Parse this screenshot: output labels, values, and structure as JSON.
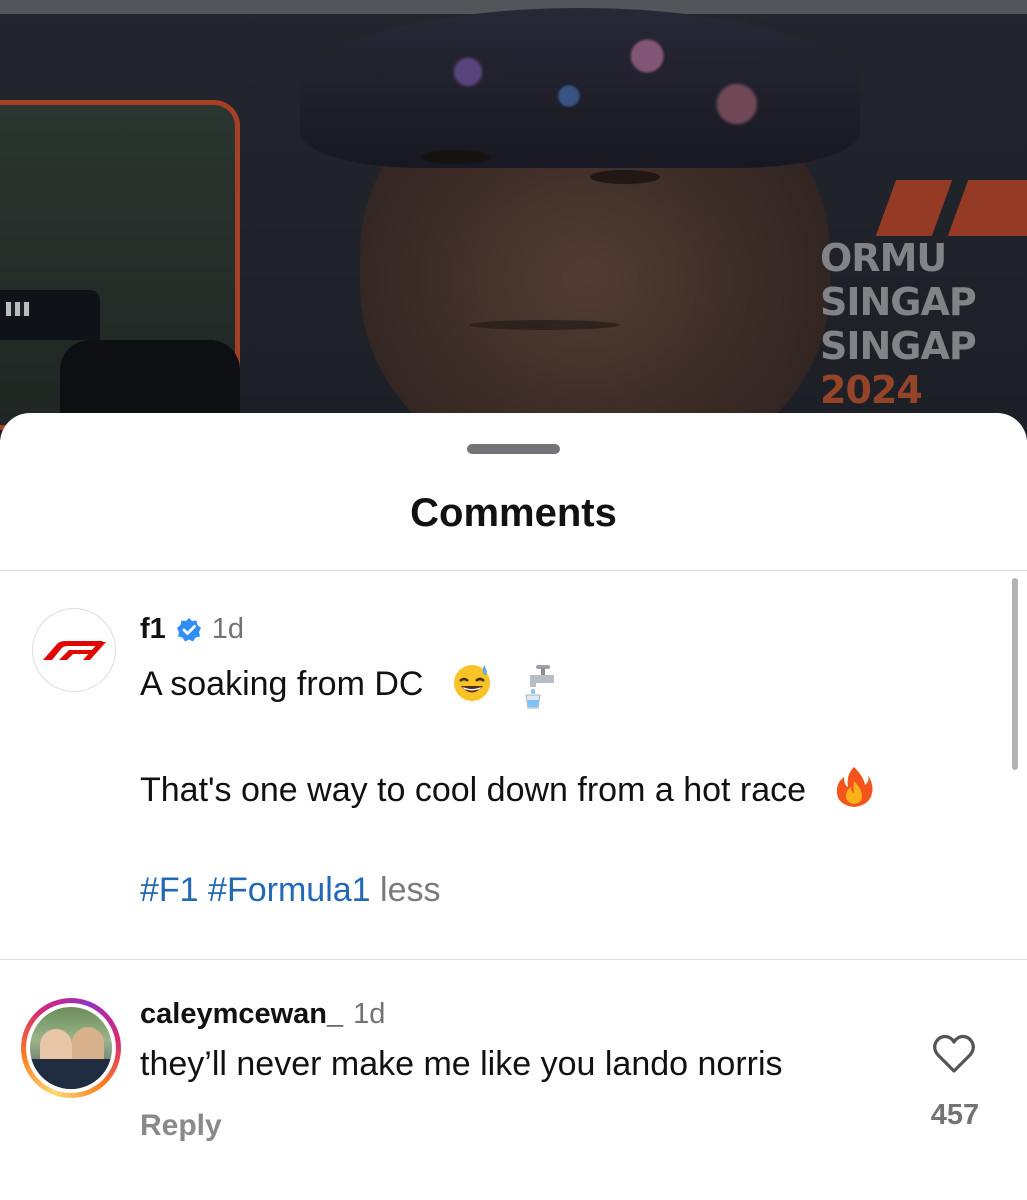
{
  "sheet": {
    "title": "Comments"
  },
  "post": {
    "author": "f1",
    "verified": true,
    "time": "1d",
    "line1": "A soaking from DC",
    "line1_emoji": [
      "grinning-sweat-emoji",
      "water-tap-emoji"
    ],
    "line2": "That's one way to cool down from a hot race",
    "line2_emoji": [
      "fire-emoji"
    ],
    "hashtags": [
      "#F1",
      "#Formula1"
    ],
    "less_label": "less"
  },
  "comments": [
    {
      "author": "caleymcewan_",
      "time": "1d",
      "text": "they’ll never make me like you lando norris",
      "reply_label": "Reply",
      "likes": "457"
    }
  ],
  "video_overlay": {
    "brand_lines": [
      "ORMU",
      "SINGAP",
      "SINGAP",
      "2024"
    ]
  },
  "colors": {
    "hashtag": "#2168b5",
    "verified_badge": "#2f8df5",
    "f1_red": "#e10600"
  }
}
